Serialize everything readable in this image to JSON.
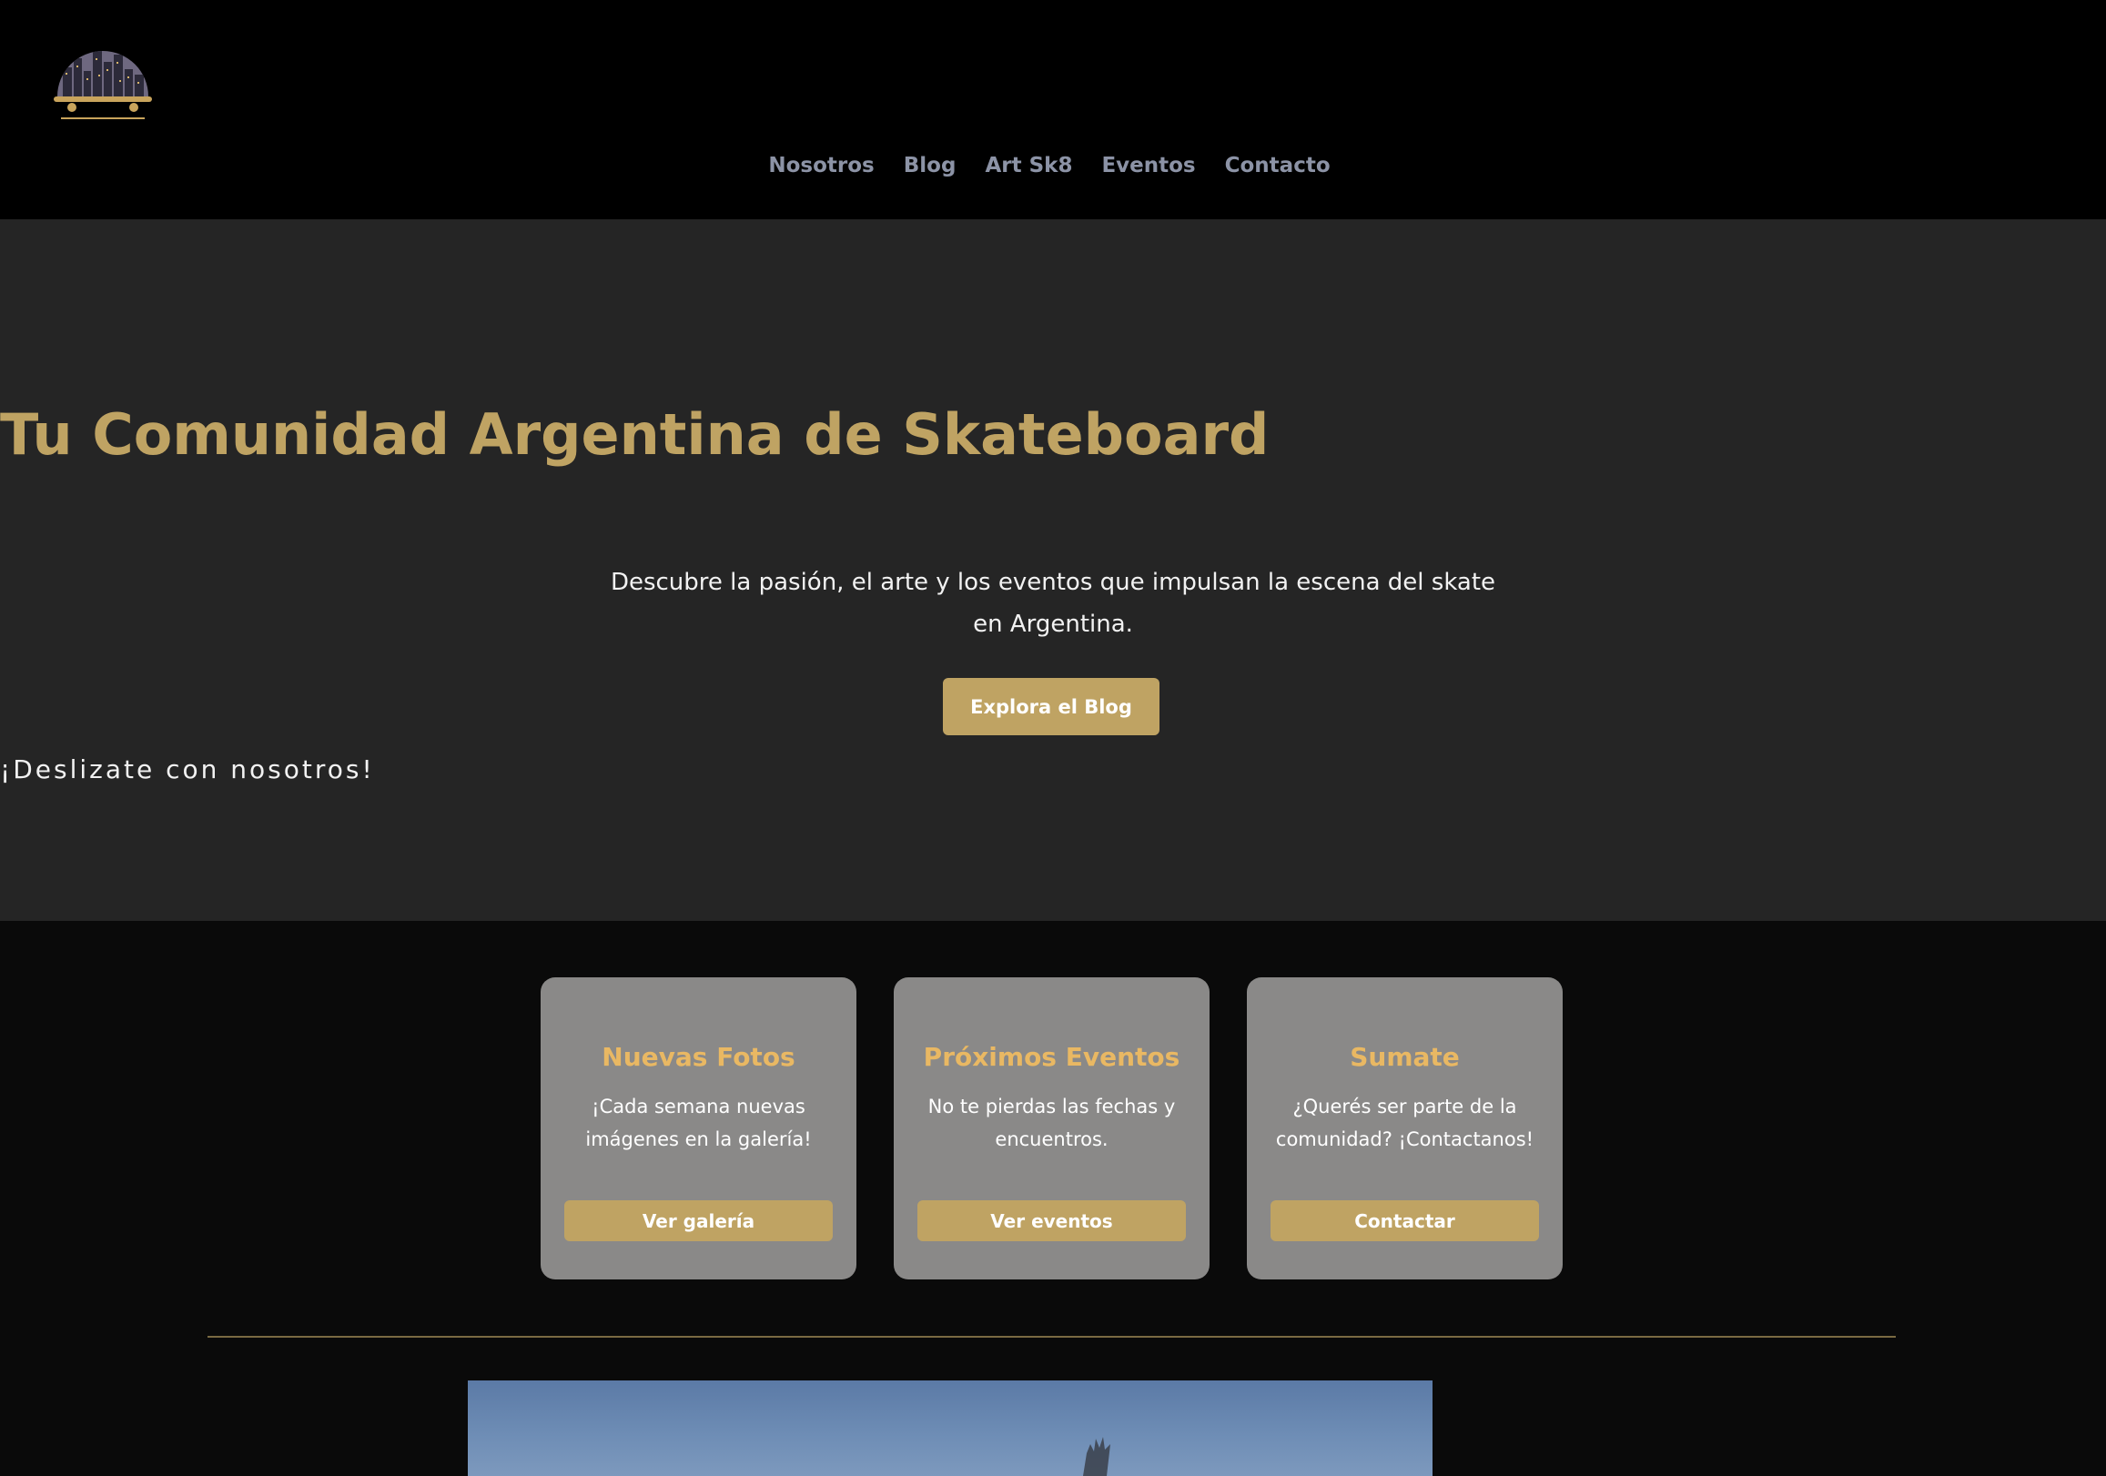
{
  "header": {
    "logo_name": "skate-city-logo",
    "nav": [
      {
        "label": "Nosotros"
      },
      {
        "label": "Blog"
      },
      {
        "label": "Art Sk8"
      },
      {
        "label": "Eventos"
      },
      {
        "label": "Contacto"
      }
    ]
  },
  "hero": {
    "title": "Tu Comunidad Argentina de Skateboard",
    "subtitle": "Descubre la pasión, el arte y los eventos que impulsan la escena del skate en Argentina.",
    "cta_label": "Explora el Blog",
    "tagline": "¡Deslizate con nosotros!"
  },
  "cards": [
    {
      "title": "Nuevas Fotos",
      "text": "¡Cada semana nuevas imágenes en la galería!",
      "button": "Ver galería"
    },
    {
      "title": "Próximos Eventos",
      "text": "No te pierdas las fechas y encuentros.",
      "button": "Ver eventos"
    },
    {
      "title": "Sumate",
      "text": "¿Querés ser parte de la comunidad? ¡Contactanos!",
      "button": "Contactar"
    }
  ],
  "colors": {
    "accent": "#bfa363",
    "card_title": "#e9b863",
    "nav_link": "#8c93a6",
    "hero_bg": "#252525",
    "header_bg": "#000000",
    "card_bg": "#8a8988"
  }
}
